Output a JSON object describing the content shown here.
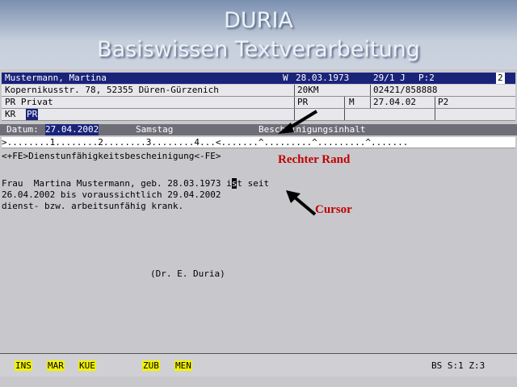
{
  "header": {
    "title": "DURIA",
    "subtitle": "Basiswissen Textverarbeitung"
  },
  "patient": {
    "name": "Mustermann, Martina",
    "sex": "W",
    "birthdate": "28.03.1973",
    "code1": "29/1 J",
    "code2": "P:2",
    "code3": "2",
    "address": "Kopernikusstr. 78, 52355 Düren-Gürzenich",
    "code4": "20KM",
    "phone": "02421/858888",
    "insurance": "PR Privat",
    "ins_code": "PR",
    "m_label": "M",
    "date2": "27.04.02",
    "p2": "P2",
    "kr_label": "KR",
    "kr_value": "PR"
  },
  "status_bar": {
    "date_label": "Datum:",
    "date_value": "27.04.2002",
    "weekday": "Samstag",
    "doc_title": "Bescheinigungsinhalt"
  },
  "ruler": ">........1........2........3........4...<.......^.........^.........^.......",
  "document": {
    "heading": "<+FE>Dienstunfähigkeitsbescheinigung<-FE>",
    "line1_pre": "Frau  Martina Mustermann, geb. 28.03.1973 i",
    "line1_cursor": "s",
    "line1_post": "t seit",
    "line2": "26.04.2002 bis voraussichtlich 29.04.2002",
    "line3": "dienst- bzw. arbeitsunfähig krank.",
    "signature": "(Dr. E. Duria)"
  },
  "annotations": {
    "margin": "Rechter Rand",
    "cursor": "Cursor"
  },
  "function_keys": [
    "INS",
    "MAR",
    "KUE",
    "ZUB",
    "MEN"
  ],
  "status_right": "BS S:1 Z:3"
}
